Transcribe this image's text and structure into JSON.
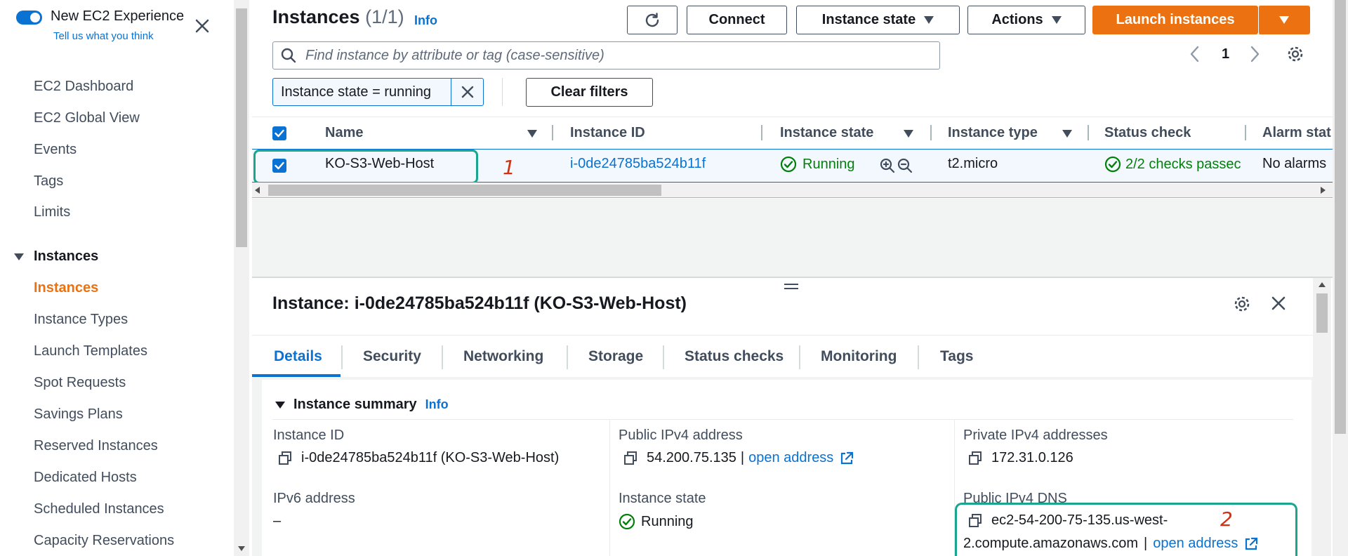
{
  "sidebar": {
    "new_experience_label": "New EC2 Experience",
    "tell_us_label": "Tell us what you think",
    "items": [
      {
        "label": "EC2 Dashboard"
      },
      {
        "label": "EC2 Global View"
      },
      {
        "label": "Events"
      },
      {
        "label": "Tags"
      },
      {
        "label": "Limits"
      }
    ],
    "section": {
      "label": "Instances",
      "items": [
        {
          "label": "Instances"
        },
        {
          "label": "Instance Types"
        },
        {
          "label": "Launch Templates"
        },
        {
          "label": "Spot Requests"
        },
        {
          "label": "Savings Plans"
        },
        {
          "label": "Reserved Instances"
        },
        {
          "label": "Dedicated Hosts"
        },
        {
          "label": "Scheduled Instances"
        },
        {
          "label": "Capacity Reservations"
        }
      ]
    }
  },
  "header": {
    "title": "Instances",
    "count": "(1/1)",
    "info": "Info",
    "connect_label": "Connect",
    "instance_state_label": "Instance state",
    "actions_label": "Actions",
    "launch_label": "Launch instances"
  },
  "search": {
    "placeholder": "Find instance by attribute or tag (case-sensitive)"
  },
  "filter": {
    "token": "Instance state = running",
    "clear_label": "Clear filters"
  },
  "pagination": {
    "page": "1"
  },
  "table": {
    "columns": [
      "Name",
      "Instance ID",
      "Instance state",
      "Instance type",
      "Status check",
      "Alarm stat"
    ],
    "row": {
      "name": "KO-S3-Web-Host",
      "instance_id": "i-0de24785ba524b11f",
      "state": "Running",
      "type": "t2.micro",
      "status_check": "2/2 checks passec",
      "alarm": "No alarms"
    }
  },
  "annotations": {
    "one": "1",
    "two": "2"
  },
  "detail": {
    "title": "Instance: i-0de24785ba524b11f (KO-S3-Web-Host)",
    "tabs": [
      "Details",
      "Security",
      "Networking",
      "Storage",
      "Status checks",
      "Monitoring",
      "Tags"
    ],
    "summary_title": "Instance summary",
    "summary_info": "Info",
    "fields": {
      "instance_id_label": "Instance ID",
      "instance_id_value": "i-0de24785ba524b11f (KO-S3-Web-Host)",
      "public_ipv4_label": "Public IPv4 address",
      "public_ipv4_value": "54.200.75.135",
      "open_address": "open address",
      "private_ipv4_label": "Private IPv4 addresses",
      "private_ipv4_value": "172.31.0.126",
      "ipv6_label": "IPv6 address",
      "ipv6_value": "–",
      "instance_state_label": "Instance state",
      "instance_state_value": "Running",
      "public_dns_label": "Public IPv4 DNS",
      "public_dns_line1": "ec2-54-200-75-135.us-west-",
      "public_dns_line2": "2.compute.amazonaws.com"
    }
  },
  "colors": {
    "accent": "#0972d3",
    "primary": "#ec7211",
    "success": "#037f0c",
    "annotation": "#1aa58f",
    "annotation_number": "#d13212"
  }
}
